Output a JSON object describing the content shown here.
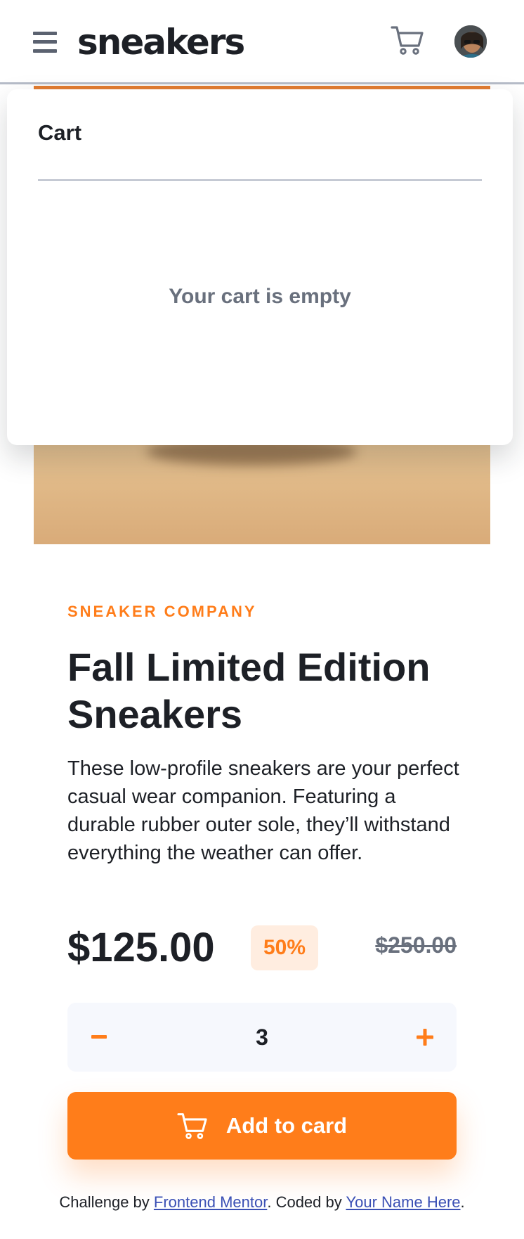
{
  "header": {
    "logo": "sneakers",
    "menu_icon": "hamburger-menu-icon",
    "cart_icon": "cart-icon",
    "avatar": "user-avatar"
  },
  "cart": {
    "title": "Cart",
    "empty_message": "Your cart is empty"
  },
  "product": {
    "company": "SNEAKER COMPANY",
    "title": "Fall Limited Edition Sneakers",
    "description": "These low-profile sneakers are your perfect casual wear companion. Featuring a durable rubber outer sole, they’ll withstand everything the weather can offer.",
    "price": "$125.00",
    "discount": "50%",
    "original_price": "$250.00"
  },
  "quantity": {
    "minus_label": "−",
    "value": "3",
    "plus_label": "+"
  },
  "add_button": {
    "label": "Add to card",
    "icon": "cart-icon"
  },
  "attribution": {
    "prefix": "Challenge by ",
    "link1": "Frontend Mentor",
    "middle": ". Coded by ",
    "link2": "Your Name Here",
    "suffix": "."
  },
  "colors": {
    "accent": "#ff7d1a",
    "accent_pale": "#ffede0",
    "dark": "#1d2026",
    "gray": "#69707d",
    "stepper_bg": "#f6f8fd"
  }
}
